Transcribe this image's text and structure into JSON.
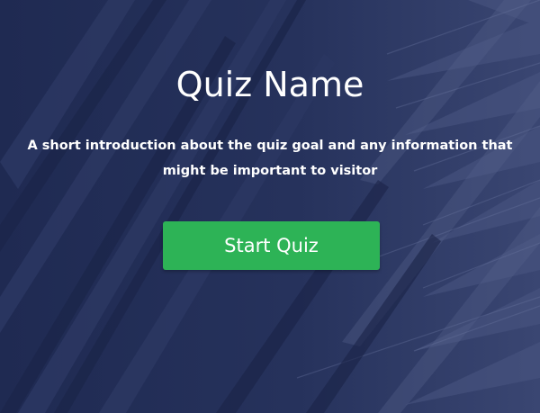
{
  "quiz": {
    "title": "Quiz Name",
    "intro": "A short introduction about the quiz goal and any information that might be important to visitor",
    "start_label": "Start Quiz"
  },
  "colors": {
    "background": "#24305a",
    "button": "#2db356",
    "text": "#ffffff"
  }
}
